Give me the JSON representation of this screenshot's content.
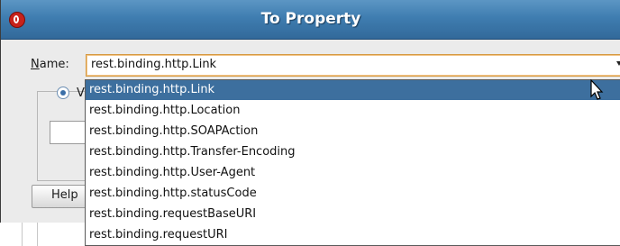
{
  "dialog": {
    "title": "To Property",
    "app_icon": "oracle-icon",
    "title_color": "#3f7db0"
  },
  "name_field": {
    "label": "Name:",
    "value": "rest.binding.http.Link"
  },
  "dropdown": {
    "selected_index": 0,
    "selected_color": "#3d6f9e",
    "options": [
      "rest.binding.http.Link",
      "rest.binding.http.Location",
      "rest.binding.http.SOAPAction",
      "rest.binding.http.Transfer-Encoding",
      "rest.binding.http.User-Agent",
      "rest.binding.http.statusCode",
      "rest.binding.requestBaseURI",
      "rest.binding.requestURI"
    ]
  },
  "obscured": {
    "radio_label": "V",
    "help_label": "Help"
  },
  "icons": {
    "cursor": "mouse-pointer-icon",
    "combo_arrow": "chevron-down-icon"
  }
}
